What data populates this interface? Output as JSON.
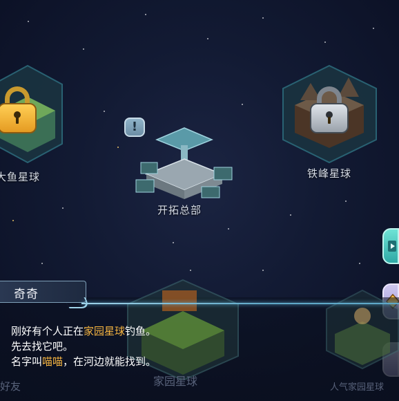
{
  "planets": {
    "dayu": {
      "label": "大鱼星球",
      "locked": true
    },
    "tiefeng": {
      "label": "铁峰星球",
      "locked": true
    },
    "hq": {
      "label": "开拓总部",
      "alert": "!"
    },
    "home": {
      "label": "家园星球"
    },
    "popular": {
      "label": "人气家园星球"
    }
  },
  "bottom_left_label": "好友",
  "dialog": {
    "speaker": "奇奇",
    "line1_a": "刚好有个人正在",
    "line1_hl": "家园星球",
    "line1_b": "钓鱼。",
    "line2": "先去找它吧。",
    "line3_a": "名字叫",
    "line3_hl": "喵喵",
    "line3_b": "，在河边就能找到。"
  },
  "colors": {
    "highlight": "#f5b441",
    "lock_gold": "#f2b53a",
    "lock_silver": "#b9c0c8",
    "accent_cyan": "#6cc6ee"
  },
  "icons": {
    "side_top": "video-icon",
    "side_mid": "diamond-icon",
    "side_bottom": "blank-icon"
  }
}
